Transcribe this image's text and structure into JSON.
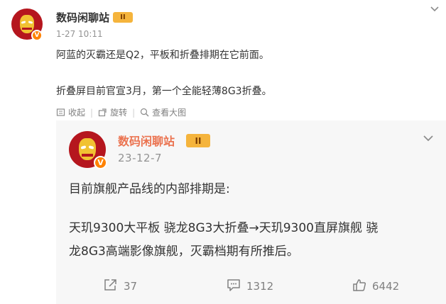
{
  "post": {
    "author": "数码闲聊站",
    "level_badge": "II",
    "time": "1-27 10:11",
    "paragraphs": [
      "阿蓝的灭霸还是Q2，平板和折叠排期在它前面。",
      "折叠屏目前官宣3月，第一个全能轻薄8G3折叠。"
    ],
    "actions": [
      {
        "icon": "bookmark-icon",
        "label": "收起"
      },
      {
        "icon": "rotate-icon",
        "label": "旋转"
      },
      {
        "icon": "magnify-icon",
        "label": "查看大图"
      }
    ],
    "verified_mark": "V"
  },
  "repost": {
    "author": "数码闲聊站",
    "level_badge": "II",
    "time": "23-12-7",
    "verified_mark": "V",
    "lines": [
      "目前旗舰产品线的内部排期是:",
      "天玑9300大平板 骁龙8G3大折叠→天玑9300直屏旗舰 骁",
      "龙8G3高端影像旗舰，灭霸档期有所推后。"
    ],
    "stats": {
      "reposts": "37",
      "comments": "1312",
      "likes": "6442"
    }
  },
  "colors": {
    "author_accent": "#eb7350",
    "verified": "#ff8200",
    "badge": "#f5b43c",
    "muted": "#939393"
  }
}
